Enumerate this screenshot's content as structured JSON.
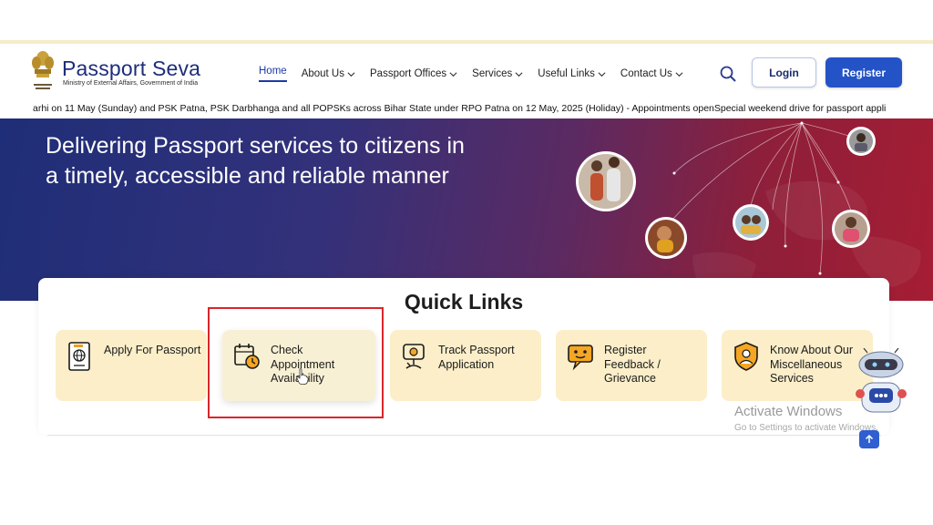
{
  "brand": {
    "title": "Passport Seva",
    "subtitle": "Ministry of External Affairs, Government of India"
  },
  "nav": {
    "items": [
      {
        "label": "Home",
        "active": true
      },
      {
        "label": "About Us",
        "dropdown": true
      },
      {
        "label": "Passport Offices",
        "dropdown": true
      },
      {
        "label": "Services",
        "dropdown": true
      },
      {
        "label": "Useful Links",
        "dropdown": true
      },
      {
        "label": "Contact Us",
        "dropdown": true
      }
    ],
    "search_icon": "search-icon",
    "login_label": "Login",
    "register_label": "Register"
  },
  "ticker": {
    "text": "arhi on 11 May (Sunday) and PSK Patna, PSK Darbhanga and all POPSKs across Bihar State under RPO Patna on 12 May, 2025 (Holiday) - Appointments openSpecial weekend drive for passport appli"
  },
  "hero": {
    "heading": "Delivering Passport services to citizens in a timely, accessible and reliable manner"
  },
  "quick_links": {
    "title": "Quick Links",
    "cards": [
      {
        "label": "Apply For Passport",
        "icon": "passport-icon"
      },
      {
        "label": "Check Appointment Availability",
        "icon": "calendar-clock-icon"
      },
      {
        "label": "Track Passport Application",
        "icon": "track-icon"
      },
      {
        "label": "Register Feedback / Grievance",
        "icon": "feedback-icon"
      },
      {
        "label": "Know About Our Miscellaneous Services",
        "icon": "shield-services-icon"
      }
    ]
  },
  "watermark": {
    "title": "Activate Windows",
    "subtitle": "Go to Settings to activate Windows."
  },
  "colors": {
    "brand_blue": "#1e2d7a",
    "register_blue": "#2453c7",
    "card_bg": "#fbeec9",
    "highlight_red": "#d8262c"
  }
}
